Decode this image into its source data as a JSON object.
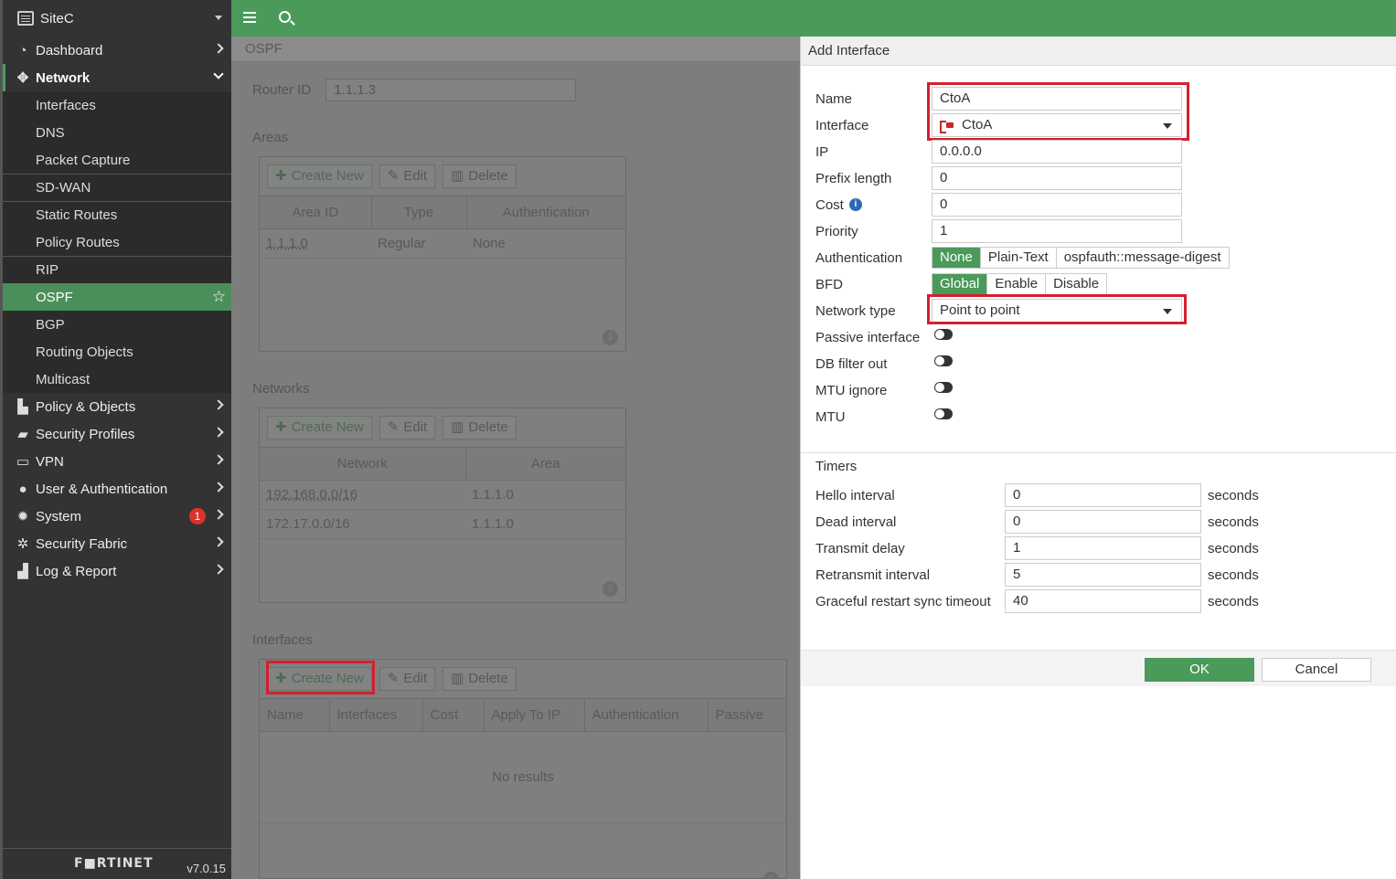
{
  "sidebar": {
    "site_name": "SiteC",
    "items": [
      {
        "label": "Dashboard"
      },
      {
        "label": "Network"
      },
      {
        "label": "Policy & Objects"
      },
      {
        "label": "Security Profiles"
      },
      {
        "label": "VPN"
      },
      {
        "label": "User & Authentication"
      },
      {
        "label": "System",
        "badge": "1"
      },
      {
        "label": "Security Fabric"
      },
      {
        "label": "Log & Report"
      }
    ],
    "network_sub": [
      {
        "label": "Interfaces"
      },
      {
        "label": "DNS"
      },
      {
        "label": "Packet Capture"
      },
      {
        "label": "SD-WAN"
      },
      {
        "label": "Static Routes"
      },
      {
        "label": "Policy Routes"
      },
      {
        "label": "RIP"
      },
      {
        "label": "OSPF"
      },
      {
        "label": "BGP"
      },
      {
        "label": "Routing Objects"
      },
      {
        "label": "Multicast"
      }
    ],
    "logo": "F■RTINET",
    "version": "v7.0.15"
  },
  "main": {
    "title": "OSPF",
    "router_id_label": "Router ID",
    "router_id_value": "1.1.1.3",
    "areas": {
      "title": "Areas",
      "buttons": {
        "create": "Create New",
        "edit": "Edit",
        "delete": "Delete"
      },
      "columns": [
        "Area ID",
        "Type",
        "Authentication"
      ],
      "rows": [
        [
          "1.1.1.0",
          "Regular",
          "None"
        ]
      ],
      "count": "1"
    },
    "networks": {
      "title": "Networks",
      "buttons": {
        "create": "Create New",
        "edit": "Edit",
        "delete": "Delete"
      },
      "columns": [
        "Network",
        "Area"
      ],
      "rows": [
        [
          "192.168.0.0/16",
          "1.1.1.0"
        ],
        [
          "172.17.0.0/16",
          "1.1.1.0"
        ]
      ],
      "count": "2"
    },
    "interfaces": {
      "title": "Interfaces",
      "buttons": {
        "create": "Create New",
        "edit": "Edit",
        "delete": "Delete"
      },
      "columns": [
        "Name",
        "Interfaces",
        "Cost",
        "Apply To IP",
        "Authentication",
        "Passive"
      ],
      "empty": "No results",
      "count": "0"
    }
  },
  "dialog": {
    "title": "Add Interface",
    "fields": {
      "name_label": "Name",
      "name_value": "CtoA",
      "interface_label": "Interface",
      "interface_value": "CtoA",
      "ip_label": "IP",
      "ip_value": "0.0.0.0",
      "prefix_label": "Prefix length",
      "prefix_value": "0",
      "cost_label": "Cost",
      "cost_value": "0",
      "priority_label": "Priority",
      "priority_value": "1",
      "auth_label": "Authentication",
      "auth_options": [
        "None",
        "Plain-Text",
        "ospfauth::message-digest"
      ],
      "auth_selected": "None",
      "bfd_label": "BFD",
      "bfd_options": [
        "Global",
        "Enable",
        "Disable"
      ],
      "bfd_selected": "Global",
      "network_type_label": "Network type",
      "network_type_value": "Point to point",
      "passive_label": "Passive interface",
      "db_filter_label": "DB filter out",
      "mtu_ignore_label": "MTU ignore",
      "mtu_label": "MTU"
    },
    "timers": {
      "title": "Timers",
      "unit": "seconds",
      "rows": [
        {
          "label": "Hello interval",
          "value": "0"
        },
        {
          "label": "Dead interval",
          "value": "0"
        },
        {
          "label": "Transmit delay",
          "value": "1"
        },
        {
          "label": "Retransmit interval",
          "value": "5"
        },
        {
          "label": "Graceful restart sync timeout",
          "value": "40"
        }
      ]
    },
    "ok_label": "OK",
    "cancel_label": "Cancel"
  },
  "colors": {
    "accent": "#4b9a5a",
    "highlight": "#d51f2f",
    "sidebar_bg": "#333333"
  }
}
